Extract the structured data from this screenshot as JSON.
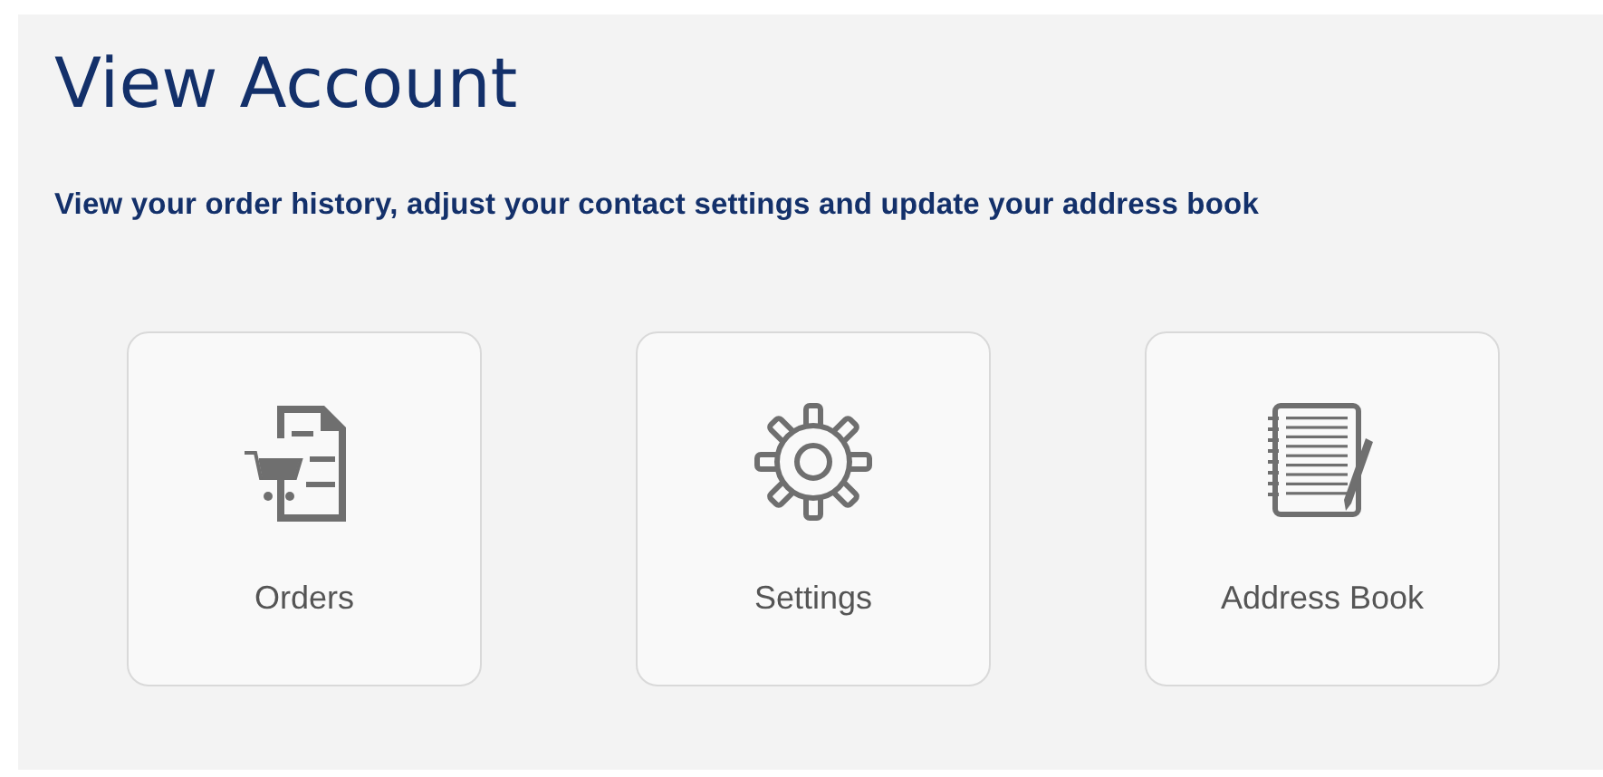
{
  "title": "View Account",
  "subtitle": "View your order history, adjust your contact settings and update your address book",
  "cards": [
    {
      "kind": "orders",
      "label": "Orders"
    },
    {
      "kind": "settings",
      "label": "Settings"
    },
    {
      "kind": "address-book",
      "label": "Address Book"
    }
  ]
}
